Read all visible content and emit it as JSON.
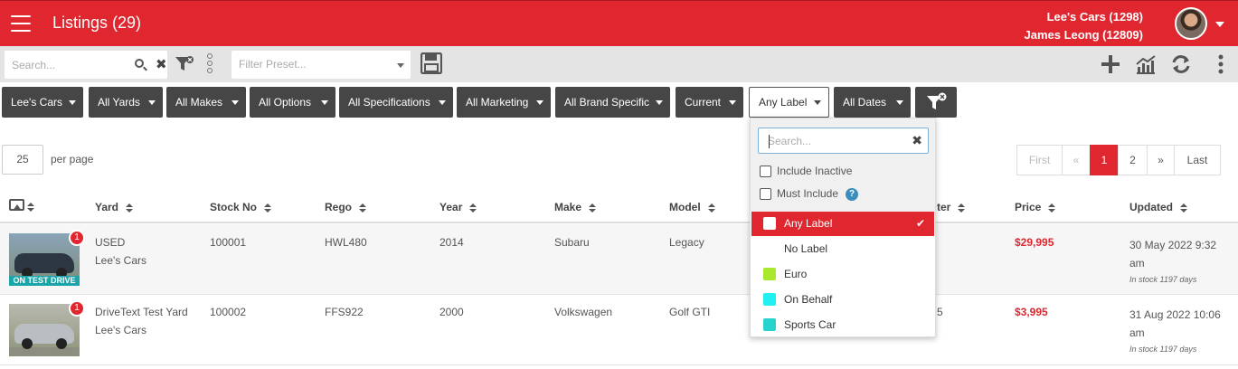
{
  "header": {
    "title": "Listings (29)",
    "account_line1": "Lee's Cars (1298)",
    "account_line2": "James Leong (12809)",
    "brand_color": "#e0262e"
  },
  "toolbar": {
    "search_placeholder": "Search...",
    "preset_placeholder": "Filter Preset..."
  },
  "filters": [
    {
      "label": "Lee's Cars"
    },
    {
      "label": "All Yards"
    },
    {
      "label": "All Makes"
    },
    {
      "label": "All Options"
    },
    {
      "label": "All Specifications"
    },
    {
      "label": "All Marketing"
    },
    {
      "label": "All Brand Specific"
    },
    {
      "label": "Current"
    },
    {
      "label": "Any Label"
    },
    {
      "label": "All Dates"
    }
  ],
  "paging": {
    "per_page_value": "25",
    "per_page_label": "per page",
    "first": "First",
    "prev": "«",
    "pages": [
      "1",
      "2"
    ],
    "current_page": "1",
    "next": "»",
    "last": "Last"
  },
  "table": {
    "columns": [
      "Yard",
      "Stock No",
      "Rego",
      "Year",
      "Make",
      "Model",
      "ter",
      "Price",
      "Updated"
    ],
    "rows": [
      {
        "yard": "USED",
        "dealer": "Lee's Cars",
        "stock": "100001",
        "rego": "HWL480",
        "year": "2014",
        "make": "Subaru",
        "model": "Legacy",
        "odo": "",
        "price": "$29,995",
        "updated": "30 May 2022 9:32 am",
        "stock_days": "In stock 1197 days",
        "badge": "1",
        "overlay": "ON TEST DRIVE"
      },
      {
        "yard": "DriveText Test Yard",
        "dealer": "Lee's Cars",
        "stock": "100002",
        "rego": "FFS922",
        "year": "2000",
        "make": "Volkswagen",
        "model": "Golf GTI",
        "odo": "5",
        "price": "$3,995",
        "updated": "31 Aug 2022 10:06 am",
        "stock_days": "In stock 1197 days",
        "badge": "1",
        "overlay": ""
      }
    ]
  },
  "label_dropdown": {
    "search_placeholder": "Search...",
    "include_inactive": "Include Inactive",
    "must_include": "Must Include",
    "help": "?",
    "options": [
      {
        "label": "Any Label",
        "color": "#ffffff",
        "selected": true
      },
      {
        "label": "No Label",
        "color": "",
        "selected": false
      },
      {
        "label": "Euro",
        "color": "#a8e92e",
        "selected": false
      },
      {
        "label": "On Behalf",
        "color": "#22f0f0",
        "selected": false
      },
      {
        "label": "Sports Car",
        "color": "#27d3cf",
        "selected": false
      }
    ]
  }
}
